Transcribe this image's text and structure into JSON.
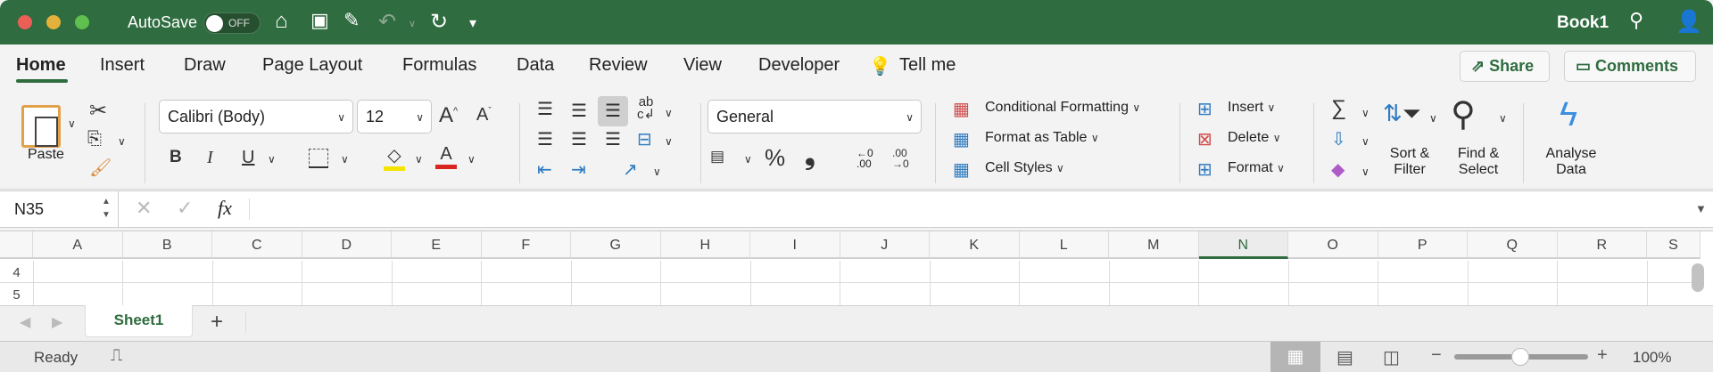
{
  "titlebar": {
    "autosave_label": "AutoSave",
    "autosave_state": "OFF",
    "title": "Book1",
    "icons": [
      "home-icon",
      "save-icon",
      "edit-icon",
      "undo-icon",
      "redo-icon",
      "customize-icon",
      "search-icon",
      "account-icon"
    ]
  },
  "tabs": [
    {
      "label": "Home",
      "active": true
    },
    {
      "label": "Insert"
    },
    {
      "label": "Draw"
    },
    {
      "label": "Page Layout"
    },
    {
      "label": "Formulas"
    },
    {
      "label": "Data"
    },
    {
      "label": "Review"
    },
    {
      "label": "View"
    },
    {
      "label": "Developer"
    },
    {
      "label": "Tell me"
    }
  ],
  "actions": {
    "share": "Share",
    "comments": "Comments"
  },
  "ribbon": {
    "paste": "Paste",
    "font_name": "Calibri (Body)",
    "font_size": "12",
    "bold": "B",
    "italic": "I",
    "underline": "U",
    "number_format": "General",
    "percent": "%",
    "comma": "❟",
    "conditional_formatting": "Conditional Formatting",
    "format_as_table": "Format as Table",
    "cell_styles": "Cell Styles",
    "insert": "Insert",
    "delete": "Delete",
    "format": "Format",
    "sort_filter": "Sort & Filter",
    "find_select": "Find & Select",
    "analyse_data": "Analyse Data",
    "fx": "fx",
    "dec_decimal": "←0 .00",
    "inc_decimal": ".00 →0"
  },
  "formula_bar": {
    "name_box": "N35",
    "value": ""
  },
  "grid": {
    "columns": [
      "A",
      "B",
      "C",
      "D",
      "E",
      "F",
      "G",
      "H",
      "I",
      "J",
      "K",
      "L",
      "M",
      "N",
      "O",
      "P",
      "Q",
      "R",
      "S"
    ],
    "selected_column": "N",
    "rows": [
      "4",
      "5"
    ]
  },
  "sheets": {
    "tabs": [
      "Sheet1"
    ],
    "add": "+"
  },
  "status": {
    "text": "Ready",
    "zoom": "100%"
  },
  "colors": {
    "brand": "#2f6c3f",
    "accent_yellow": "#f5e400",
    "accent_red": "#d8231f"
  }
}
